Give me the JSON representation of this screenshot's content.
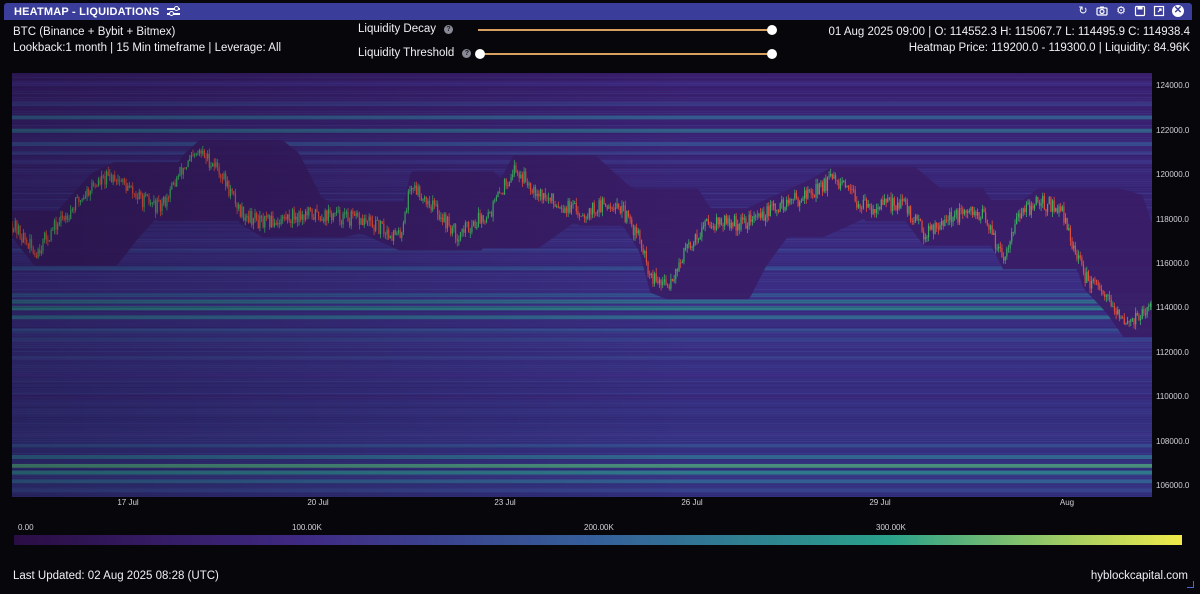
{
  "window": {
    "title": "HEATMAP - LIQUIDATIONS",
    "icons": [
      "filter-icon",
      "refresh-icon",
      "camera-icon",
      "gear-icon",
      "save-icon",
      "expand-icon",
      "close-icon"
    ]
  },
  "info": {
    "exchange": "BTC (Binance + Bybit + Bitmex)",
    "settings": "Lookback:1 month | 15 Min timeframe | Leverage: All",
    "ohlc": "01 Aug 2025 09:00 | O: 114552.3 H: 115067.7 L: 114495.9 C: 114938.4",
    "heatmap_price": "Heatmap Price: 119200.0 - 119300.0 | Liquidity: 84.96K"
  },
  "sliders": {
    "decay": {
      "label": "Liquidity Decay",
      "value": 1.0
    },
    "threshold": {
      "label": "Liquidity Threshold",
      "low": 0.0,
      "high": 1.0
    }
  },
  "axes": {
    "price_ticks": [
      "124000.0",
      "122000.0",
      "120000.0",
      "118000.0",
      "116000.0",
      "114000.0",
      "112000.0",
      "110000.0",
      "108000.0",
      "106000.0"
    ],
    "date_ticks": [
      "17 Jul",
      "20 Jul",
      "23 Jul",
      "26 Jul",
      "29 Jul",
      "Aug"
    ]
  },
  "colorbar": {
    "ticks": [
      "0.00",
      "100.00K",
      "200.00K",
      "300.00K"
    ],
    "colors": [
      "#2a0d44",
      "#3f2a84",
      "#35609a",
      "#2aa08a",
      "#f0ea4a"
    ]
  },
  "footer": {
    "updated": "Last Updated: 02 Aug 2025 08:28 (UTC)",
    "brand": "hyblockcapital.com"
  },
  "chart_data": {
    "type": "heatmap",
    "price_range": [
      105500,
      124600
    ],
    "candle_up_color": "#3fae63",
    "candle_down_color": "#e24e3c",
    "price_path": [
      {
        "t": 0.0,
        "p": 117800
      },
      {
        "t": 0.02,
        "p": 116500
      },
      {
        "t": 0.04,
        "p": 117800
      },
      {
        "t": 0.07,
        "p": 119500
      },
      {
        "t": 0.09,
        "p": 120000
      },
      {
        "t": 0.11,
        "p": 119000
      },
      {
        "t": 0.13,
        "p": 118500
      },
      {
        "t": 0.15,
        "p": 120300
      },
      {
        "t": 0.165,
        "p": 121000
      },
      {
        "t": 0.18,
        "p": 120400
      },
      {
        "t": 0.2,
        "p": 118400
      },
      {
        "t": 0.22,
        "p": 117800
      },
      {
        "t": 0.25,
        "p": 118200
      },
      {
        "t": 0.28,
        "p": 118200
      },
      {
        "t": 0.31,
        "p": 117900
      },
      {
        "t": 0.34,
        "p": 117200
      },
      {
        "t": 0.35,
        "p": 119600
      },
      {
        "t": 0.37,
        "p": 118600
      },
      {
        "t": 0.39,
        "p": 117300
      },
      {
        "t": 0.42,
        "p": 118400
      },
      {
        "t": 0.44,
        "p": 120300
      },
      {
        "t": 0.47,
        "p": 118900
      },
      {
        "t": 0.5,
        "p": 118300
      },
      {
        "t": 0.53,
        "p": 118800
      },
      {
        "t": 0.55,
        "p": 117200
      },
      {
        "t": 0.56,
        "p": 115300
      },
      {
        "t": 0.575,
        "p": 115000
      },
      {
        "t": 0.59,
        "p": 116500
      },
      {
        "t": 0.61,
        "p": 117900
      },
      {
        "t": 0.64,
        "p": 117800
      },
      {
        "t": 0.67,
        "p": 118500
      },
      {
        "t": 0.7,
        "p": 119200
      },
      {
        "t": 0.72,
        "p": 119800
      },
      {
        "t": 0.75,
        "p": 118500
      },
      {
        "t": 0.78,
        "p": 118800
      },
      {
        "t": 0.8,
        "p": 117400
      },
      {
        "t": 0.82,
        "p": 118100
      },
      {
        "t": 0.85,
        "p": 118300
      },
      {
        "t": 0.87,
        "p": 116300
      },
      {
        "t": 0.88,
        "p": 118000
      },
      {
        "t": 0.9,
        "p": 118800
      },
      {
        "t": 0.92,
        "p": 118500
      },
      {
        "t": 0.94,
        "p": 115500
      },
      {
        "t": 0.96,
        "p": 114400
      },
      {
        "t": 0.975,
        "p": 113300
      },
      {
        "t": 1.0,
        "p": 114000
      }
    ],
    "liquidity_bands": [
      {
        "price": 124100,
        "level": 0.25
      },
      {
        "price": 123200,
        "level": 0.35
      },
      {
        "price": 122600,
        "level": 0.55
      },
      {
        "price": 122000,
        "level": 0.6
      },
      {
        "price": 121400,
        "level": 0.45
      },
      {
        "price": 121000,
        "level": 0.35
      },
      {
        "price": 120600,
        "level": 0.3
      },
      {
        "price": 116600,
        "level": 0.35
      },
      {
        "price": 115800,
        "level": 0.45
      },
      {
        "price": 114600,
        "level": 0.5
      },
      {
        "price": 114300,
        "level": 0.62
      },
      {
        "price": 114000,
        "level": 0.7
      },
      {
        "price": 113600,
        "level": 0.6
      },
      {
        "price": 113000,
        "level": 0.45
      },
      {
        "price": 112600,
        "level": 0.4
      },
      {
        "price": 111800,
        "level": 0.35
      },
      {
        "price": 111000,
        "level": 0.25
      },
      {
        "price": 110000,
        "level": 0.2
      },
      {
        "price": 108300,
        "level": 0.3
      },
      {
        "price": 107800,
        "level": 0.45
      },
      {
        "price": 107300,
        "level": 0.6
      },
      {
        "price": 106900,
        "level": 0.8
      },
      {
        "price": 106600,
        "level": 0.7
      },
      {
        "price": 106200,
        "level": 0.55
      },
      {
        "price": 105800,
        "level": 0.4
      }
    ]
  }
}
